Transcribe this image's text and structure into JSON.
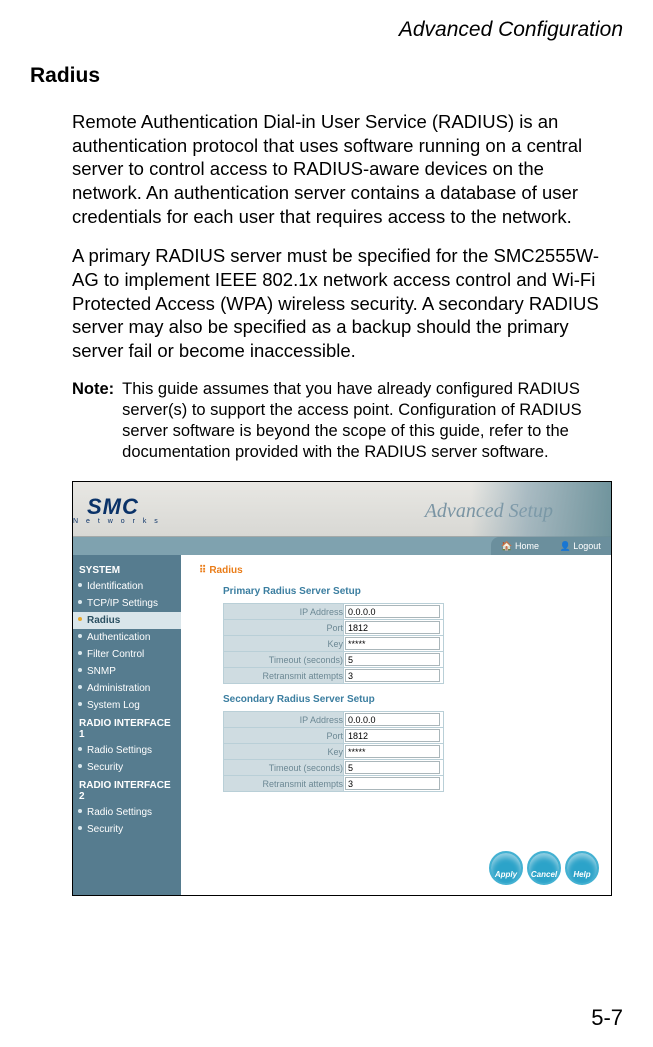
{
  "header": "Advanced Configuration",
  "section_title": "Radius",
  "para1": "Remote Authentication Dial-in User Service (RADIUS) is an authentication protocol that uses software running on a central server to control access to RADIUS-aware devices on the network. An authentication server contains a database of user credentials for each user that requires access to the network.",
  "para2": "A primary RADIUS server must be specified for the SMC2555W-AG to implement IEEE 802.1x network access control and Wi-Fi Protected Access (WPA) wireless security. A secondary RADIUS server may also be specified as a backup should the primary server fail or become inaccessible.",
  "note_label": "Note:",
  "note_text": "This guide assumes that you have already configured RADIUS server(s) to support the access point. Configuration of RADIUS server software is beyond the scope of this guide, refer to the documentation provided with the RADIUS server software.",
  "page_num": "5-7",
  "ui": {
    "logo": "SMC",
    "logo_sub": "N e t w o r k s",
    "banner": "Advanced Setup",
    "home": "Home",
    "logout": "Logout",
    "sidebar": {
      "g1": "SYSTEM",
      "g1_items": [
        "Identification",
        "TCP/IP Settings",
        "Radius",
        "Authentication",
        "Filter Control",
        "SNMP",
        "Administration",
        "System Log"
      ],
      "g2": "RADIO INTERFACE 1",
      "g2_items": [
        "Radio Settings",
        "Security"
      ],
      "g3": "RADIO INTERFACE 2",
      "g3_items": [
        "Radio Settings",
        "Security"
      ]
    },
    "page_title": "Radius",
    "primary_hd": "Primary Radius Server Setup",
    "secondary_hd": "Secondary Radius Server Setup",
    "labels": {
      "ip": "IP Address",
      "port": "Port",
      "key": "Key",
      "timeout": "Timeout (seconds)",
      "retrans": "Retransmit attempts"
    },
    "primary": {
      "ip": "0.0.0.0",
      "port": "1812",
      "key": "*****",
      "timeout": "5",
      "retrans": "3"
    },
    "secondary": {
      "ip": "0.0.0.0",
      "port": "1812",
      "key": "*****",
      "timeout": "5",
      "retrans": "3"
    },
    "buttons": {
      "apply": "Apply",
      "cancel": "Cancel",
      "help": "Help"
    }
  }
}
